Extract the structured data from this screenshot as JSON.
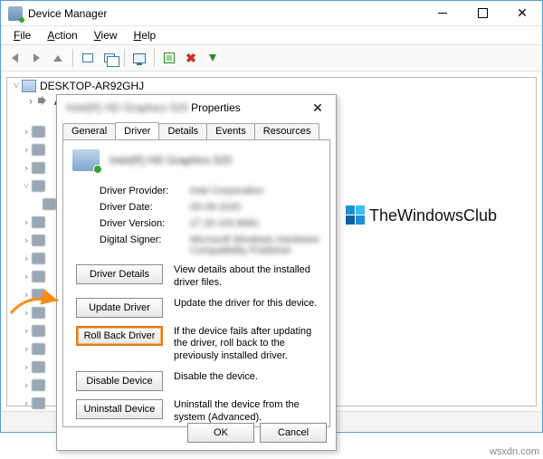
{
  "window": {
    "title": "Device Manager",
    "menus": [
      "File",
      "Action",
      "View",
      "Help"
    ],
    "underlines": [
      "F",
      "A",
      "V",
      "H"
    ]
  },
  "tree": {
    "root": "DESKTOP-AR92GHJ",
    "first_category": "Audio inputs and outputs"
  },
  "dialog": {
    "title_suffix": "Properties",
    "tabs": [
      "General",
      "Driver",
      "Details",
      "Events",
      "Resources"
    ],
    "active_tab": "Driver",
    "info": {
      "provider_label": "Driver Provider:",
      "date_label": "Driver Date:",
      "version_label": "Driver Version:",
      "signer_label": "Digital Signer:"
    },
    "actions": {
      "details": {
        "btn": "Driver Details",
        "desc": "View details about the installed driver files."
      },
      "update": {
        "btn": "Update Driver",
        "desc": "Update the driver for this device."
      },
      "rollback": {
        "btn": "Roll Back Driver",
        "desc": "If the device fails after updating the driver, roll back to the previously installed driver."
      },
      "disable": {
        "btn": "Disable Device",
        "desc": "Disable the device."
      },
      "uninstall": {
        "btn": "Uninstall Device",
        "desc": "Uninstall the device from the system (Advanced)."
      }
    },
    "footer": {
      "ok": "OK",
      "cancel": "Cancel"
    }
  },
  "brand": "TheWindowsClub",
  "watermark": "wsxdn.com"
}
